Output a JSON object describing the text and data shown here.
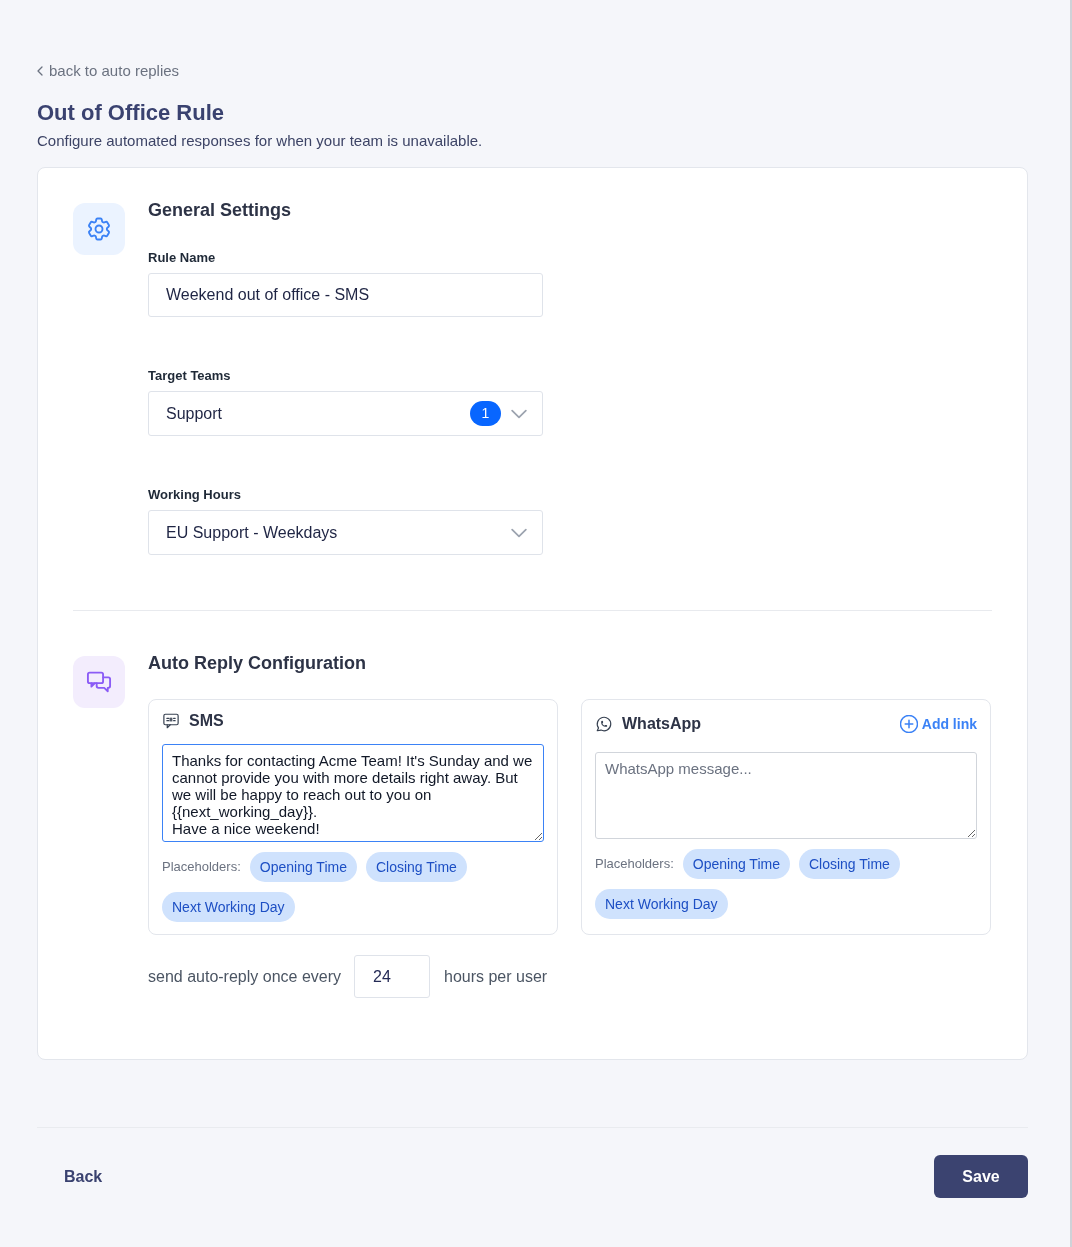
{
  "back_link": {
    "label": "back to auto replies"
  },
  "page": {
    "title": "Out of Office Rule",
    "subtitle": "Configure automated responses for when your team is unavailable."
  },
  "general_settings": {
    "title": "General Settings",
    "fields": [
      {
        "kind": "text",
        "label": "Rule Name",
        "value": "Weekend out of office - SMS"
      },
      {
        "kind": "select",
        "label": "Target Teams",
        "value": "Support",
        "count": "1"
      },
      {
        "kind": "select",
        "label": "Working Hours",
        "value": "EU Support - Weekdays"
      }
    ]
  },
  "auto_reply": {
    "title": "Auto Reply Configuration",
    "channels": [
      {
        "kind": "sms",
        "name": "SMS",
        "focused": true,
        "message": "Thanks for contacting Acme Team! It's Sunday and we cannot provide you with more details right away. But we will be happy to reach out to you on {{next_working_day}}.\nHave a nice weekend!",
        "placeholders_label": "Placeholders:",
        "placeholders": [
          "Opening Time",
          "Closing Time",
          "Next Working Day"
        ]
      },
      {
        "kind": "whatsapp",
        "name": "WhatsApp",
        "action": "Add link",
        "focused": false,
        "placeholder": "WhatsApp message...",
        "placeholders_label": "Placeholders:",
        "placeholders": [
          "Opening Time",
          "Closing Time",
          "Next Working Day"
        ]
      }
    ],
    "frequency": {
      "prefix": "send auto-reply once every",
      "value": "24",
      "suffix": "hours per user"
    }
  },
  "footer": {
    "back": "Back",
    "save": "Save"
  }
}
